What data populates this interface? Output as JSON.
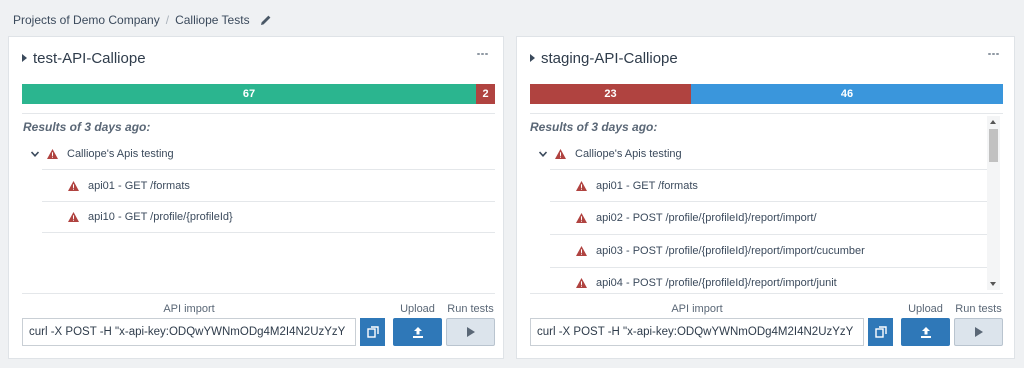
{
  "breadcrumb": {
    "company": "Projects of Demo Company",
    "separator": "/",
    "project": "Calliope Tests"
  },
  "cards": [
    {
      "title": "test-API-Calliope",
      "bar": [
        {
          "label": "67",
          "color": "#2bb58f",
          "fraction": 0.971
        },
        {
          "label": "2",
          "color": "#b04340",
          "fraction": 0.029
        }
      ],
      "results_label": "Results of 3 days ago:",
      "group": "Calliope's Apis testing",
      "items": [
        "api01 - GET /formats",
        "api10 - GET /profile/{profileId}"
      ],
      "api_import_label": "API import",
      "curl_value": "curl -X POST -H \"x-api-key:ODQwYWNmODg4M2I4N2UzYzY",
      "upload_label": "Upload",
      "run_label": "Run tests"
    },
    {
      "title": "staging-API-Calliope",
      "bar": [
        {
          "label": "23",
          "color": "#b04340",
          "fraction": 0.333
        },
        {
          "label": "46",
          "color": "#3a96dc",
          "fraction": 0.667
        }
      ],
      "results_label": "Results of 3 days ago:",
      "group": "Calliope's Apis testing",
      "items": [
        "api01 - GET /formats",
        "api02 - POST /profile/{profileId}/report/import/",
        "api03 - POST /profile/{profileId}/report/import/cucumber",
        "api04 - POST /profile/{profileId}/report/import/junit"
      ],
      "api_import_label": "API import",
      "curl_value": "curl -X POST -H \"x-api-key:ODQwYWNmODg4M2I4N2UzYzY",
      "upload_label": "Upload",
      "run_label": "Run tests"
    }
  ],
  "colors": {
    "warning": "#b04340",
    "primary_button": "#2f78b8"
  }
}
